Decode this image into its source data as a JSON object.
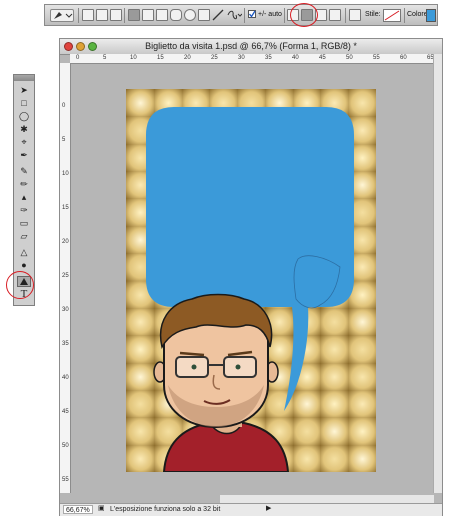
{
  "options_bar": {
    "auto_add_delete_label": "+/- auto",
    "style_label": "Stile:",
    "color_label": "Colore:",
    "color_value": "#3b9ad9"
  },
  "document": {
    "title": "Biglietto da visita 1.psd @ 66,7% (Forma 1, RGB/8) *",
    "ruler_top": [
      "0",
      "5",
      "10",
      "15",
      "20",
      "25",
      "30",
      "35",
      "40",
      "45",
      "50",
      "55",
      "60",
      "65"
    ],
    "ruler_left": [
      "0",
      "5",
      "10",
      "15",
      "20",
      "25",
      "30",
      "35",
      "40",
      "45",
      "50",
      "55",
      "60"
    ]
  },
  "status_bar": {
    "zoom": "66,67%",
    "message": "L'esposizione funziona solo a 32 bit"
  },
  "tools": [
    "move-tool",
    "marquee-tool",
    "lasso-tool",
    "quick-selection-tool",
    "crop-tool",
    "eyedropper-tool",
    "healing-brush-tool",
    "brush-tool",
    "clone-stamp-tool",
    "history-brush-tool",
    "eraser-tool",
    "paint-bucket-tool",
    "blur-tool",
    "dodge-tool",
    "pen-tool",
    "type-tool"
  ],
  "colors": {
    "speech_bubble": "#3b9ad9",
    "highlight_ring": "#d81d24",
    "canvas_background": "#ead9a2"
  }
}
